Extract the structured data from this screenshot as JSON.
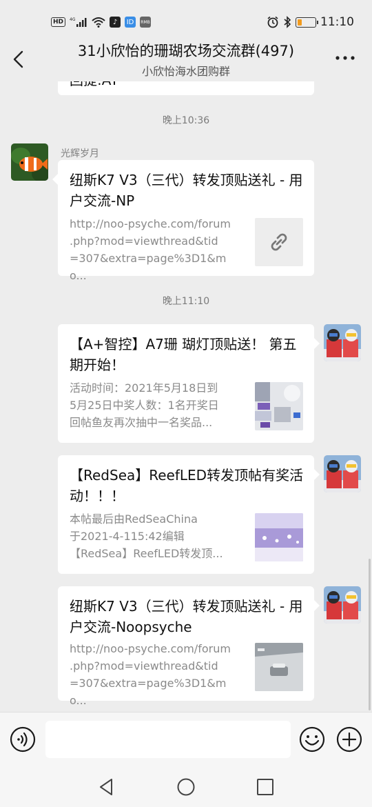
{
  "status_bar": {
    "hd_label": "HD",
    "network_label": "4G",
    "app_badge_2": "ID",
    "app_badge_3": "RMB",
    "time": "11:10",
    "battery_level": 0.25
  },
  "header": {
    "title": "31小欣怡的珊瑚农场交流群(497)",
    "subtitle": "小欣怡海水团购群"
  },
  "chat": {
    "partial_text": "回提:AT",
    "time_1": "晚上10:36",
    "sender_1": "光辉岁月",
    "msg_1": {
      "title": "纽斯K7 V3（三代）转发顶贴送礼 - 用户交流-NP",
      "desc_line1": "http://noo-psyche.com/forum",
      "desc_line2": ".php?mod=viewthread&tid",
      "desc_line3": "=307&extra=page%3D1&mo..."
    },
    "time_2": "晚上11:10",
    "msg_2": {
      "title": "【A+智控】A7珊 瑚灯顶贴送！ 第五期开始！",
      "desc_line1": "活动时间：2021年5月18日到",
      "desc_line2": "5月25日中奖人数：1名开奖日",
      "desc_line3": "回帖鱼友再次抽中一名奖品..."
    },
    "msg_3": {
      "title": "【RedSea】ReefLED转发顶帖有奖活动！！！",
      "desc_line1": "本帖最后由RedSeaChina",
      "desc_line2": "于2021-4-115:42编辑",
      "desc_line3": "【RedSea】ReefLED转发顶..."
    },
    "msg_4": {
      "title": "纽斯K7 V3（三代）转发顶贴送礼 - 用户交流-Noopsyche",
      "desc_line1": "http://noo-psyche.com/forum",
      "desc_line2": ".php?mod=viewthread&tid",
      "desc_line3": "=307&extra=page%3D1&mo..."
    }
  },
  "input": {
    "value": "",
    "placeholder": ""
  },
  "icons": {
    "back": "back-arrow-icon",
    "more": "more-dots-icon",
    "link": "link-icon",
    "voice": "voice-icon",
    "emoji": "emoji-icon",
    "plus": "plus-icon"
  },
  "colors": {
    "background": "#ededed",
    "bubble": "#ffffff",
    "battery": "#f29b1d",
    "secondary_text": "#8a8a8a"
  }
}
